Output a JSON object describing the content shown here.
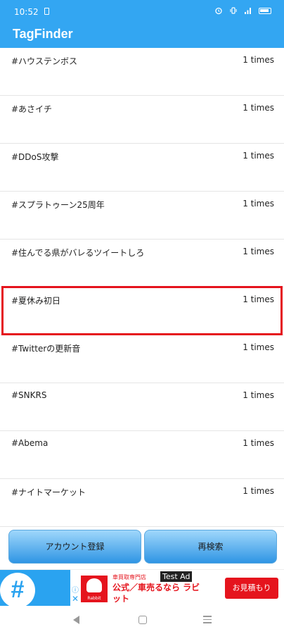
{
  "status": {
    "time": "10:52"
  },
  "app": {
    "title": "TagFinder"
  },
  "tags": [
    {
      "tag": "#ハウステンボス",
      "count": "1 times"
    },
    {
      "tag": "#あさイチ",
      "count": "1 times"
    },
    {
      "tag": "#DDoS攻撃",
      "count": "1 times"
    },
    {
      "tag": "#スプラトゥーン25周年",
      "count": "1 times"
    },
    {
      "tag": "#住んでる県がバレるツイートしろ",
      "count": "1 times"
    },
    {
      "tag": "#夏休み初日",
      "count": "1 times",
      "highlighted": true
    },
    {
      "tag": "#Twitterの更新音",
      "count": "1 times"
    },
    {
      "tag": "#SNKRS",
      "count": "1 times"
    },
    {
      "tag": "#Abema",
      "count": "1 times"
    },
    {
      "tag": "#ナイトマーケット",
      "count": "1 times"
    }
  ],
  "buttons": {
    "register": "アカウント登録",
    "research": "再検索"
  },
  "ad": {
    "small_text": "車買取専門店",
    "main_text": "公式／車売るなら ラビット",
    "test_label": "Test Ad",
    "cta": "お見積もり",
    "logo_text": "Rabbit"
  },
  "colors": {
    "primary": "#33a6f2",
    "highlight": "#e5141d"
  }
}
